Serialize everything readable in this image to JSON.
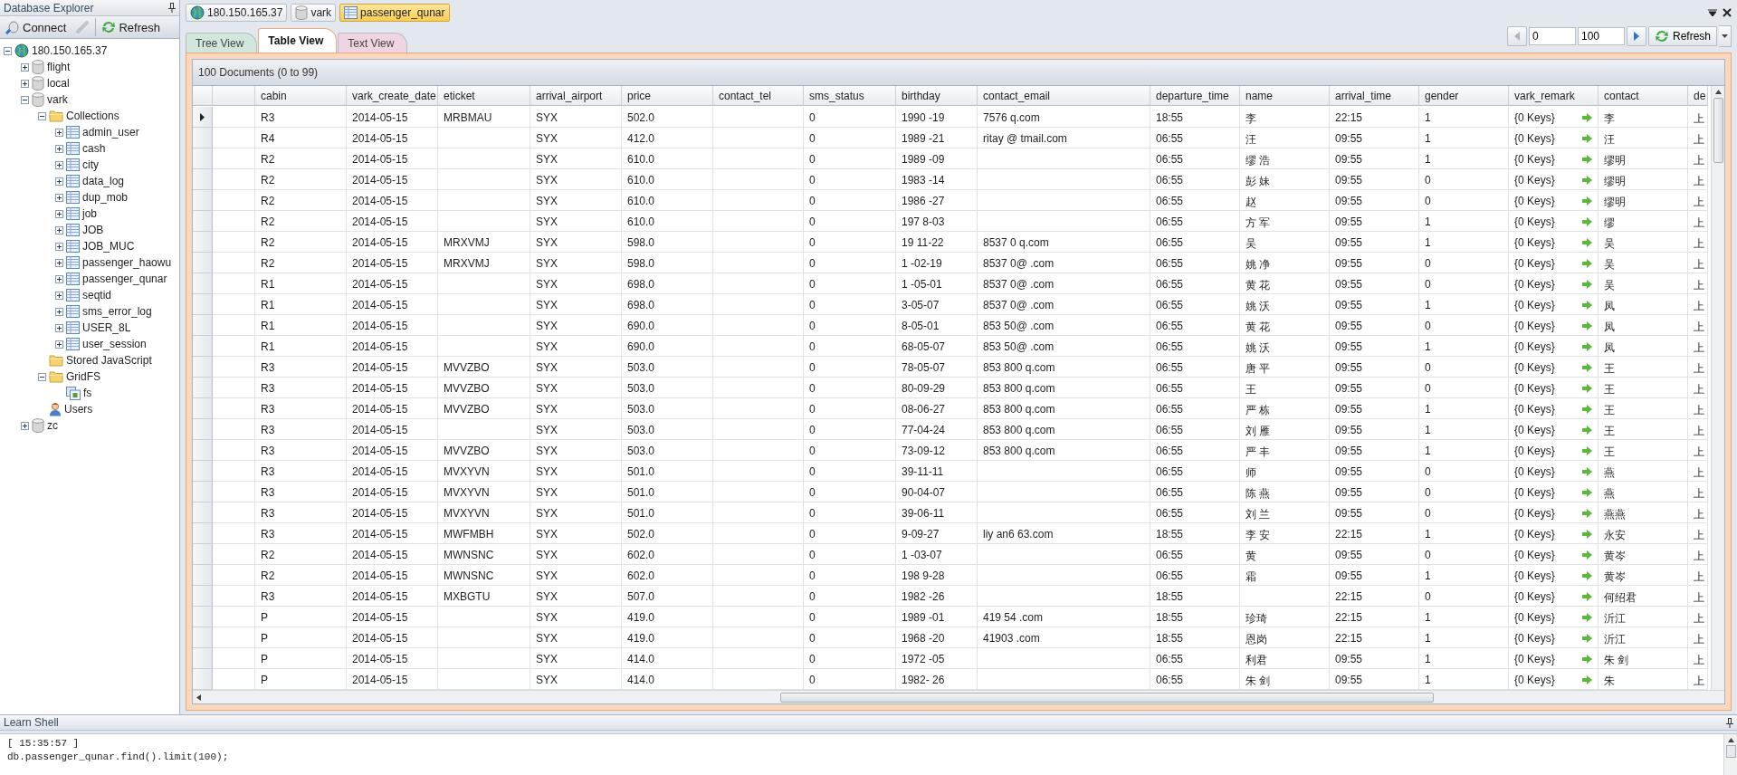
{
  "explorer": {
    "title": "Database Explorer",
    "toolbar": [
      {
        "kind": "connect",
        "label": "Connect",
        "disabled": false
      },
      {
        "kind": "disconnect",
        "disabled": true
      },
      {
        "kind": "refresh",
        "label": "Refresh",
        "disabled": false
      }
    ],
    "tree": [
      {
        "kind": "server",
        "label": "180.150.165.37",
        "expanded": true,
        "children": [
          {
            "kind": "database",
            "label": "flight",
            "expanded": false
          },
          {
            "kind": "database",
            "label": "local",
            "expanded": false
          },
          {
            "kind": "database",
            "label": "vark",
            "expanded": true,
            "children": [
              {
                "kind": "folder",
                "label": "Collections",
                "expanded": true,
                "children": [
                  {
                    "kind": "collection",
                    "label": "admin_user",
                    "expanded": false
                  },
                  {
                    "kind": "collection",
                    "label": "cash",
                    "expanded": false
                  },
                  {
                    "kind": "collection",
                    "label": "city",
                    "expanded": false
                  },
                  {
                    "kind": "collection",
                    "label": "data_log",
                    "expanded": false
                  },
                  {
                    "kind": "collection",
                    "label": "dup_mob",
                    "expanded": false
                  },
                  {
                    "kind": "collection",
                    "label": "job",
                    "expanded": false
                  },
                  {
                    "kind": "collection",
                    "label": "JOB",
                    "expanded": false
                  },
                  {
                    "kind": "collection",
                    "label": "JOB_MUC",
                    "expanded": false
                  },
                  {
                    "kind": "collection",
                    "label": "passenger_haowu",
                    "expanded": false
                  },
                  {
                    "kind": "collection",
                    "label": "passenger_qunar",
                    "expanded": false
                  },
                  {
                    "kind": "collection",
                    "label": "seqtid",
                    "expanded": false
                  },
                  {
                    "kind": "collection",
                    "label": "sms_error_log",
                    "expanded": false
                  },
                  {
                    "kind": "collection",
                    "label": "USER_8L",
                    "expanded": false
                  },
                  {
                    "kind": "collection",
                    "label": "user_session",
                    "expanded": false
                  }
                ]
              },
              {
                "kind": "folder",
                "label": "Stored JavaScript"
              },
              {
                "kind": "folder",
                "label": "GridFS",
                "expanded": true,
                "children": [
                  {
                    "kind": "gridfs",
                    "label": "fs"
                  }
                ]
              },
              {
                "kind": "users",
                "label": "Users"
              }
            ]
          },
          {
            "kind": "database",
            "label": "zc",
            "expanded": false
          }
        ]
      }
    ]
  },
  "breadcrumbs": [
    {
      "kind": "server",
      "label": "180.150.165.37",
      "selected": false
    },
    {
      "kind": "database",
      "label": "vark",
      "selected": false
    },
    {
      "kind": "collection",
      "label": "passenger_qunar",
      "selected": true
    }
  ],
  "view_tabs": [
    {
      "label": "Tree View",
      "selected": false,
      "color": "#d3e6dc"
    },
    {
      "label": "Table View",
      "selected": true,
      "color": "#ffffff"
    },
    {
      "label": "Text View",
      "selected": false,
      "color": "#f0d4e2"
    }
  ],
  "pager": {
    "start": "0",
    "limit": "100",
    "refresh": "Refresh"
  },
  "grid": {
    "summary": "100 Documents (0 to 99)",
    "columns": [
      {
        "label": "cabin",
        "kind": "text"
      },
      {
        "label": "vark_create_date",
        "kind": "text"
      },
      {
        "label": "eticket",
        "kind": "text"
      },
      {
        "label": "arrival_airport",
        "kind": "text"
      },
      {
        "label": "price",
        "kind": "text"
      },
      {
        "label": "contact_tel",
        "kind": "text"
      },
      {
        "label": "sms_status",
        "kind": "text"
      },
      {
        "label": "birthday",
        "kind": "text"
      },
      {
        "label": "contact_email",
        "kind": "text"
      },
      {
        "label": "departure_time",
        "kind": "text"
      },
      {
        "label": "name",
        "kind": "text"
      },
      {
        "label": "arrival_time",
        "kind": "text"
      },
      {
        "label": "gender",
        "kind": "text"
      },
      {
        "label": "vark_remark",
        "kind": "object"
      },
      {
        "label": "contact",
        "kind": "text"
      },
      {
        "label": "de",
        "kind": "text"
      }
    ],
    "rows": [
      {
        "current": true,
        "cells": [
          "R3",
          "2014-05-15",
          "MRBMAU",
          "SYX",
          "502.0",
          null,
          "0",
          "1990  -19",
          "7576   q.com",
          "18:55",
          "李",
          "22:15",
          "1",
          "{0 Keys}",
          "李",
          "上"
        ]
      },
      {
        "current": false,
        "cells": [
          "R4",
          "2014-05-15",
          null,
          "SYX",
          "412.0",
          null,
          "0",
          "1989  -21",
          "ritay  @  tmail.com",
          "06:55",
          "汪",
          "09:55",
          "1",
          "{0 Keys}",
          "汪",
          "上"
        ]
      },
      {
        "current": false,
        "cells": [
          "R2",
          "2014-05-15",
          null,
          "SYX",
          "610.0",
          null,
          "0",
          "1989  -09",
          null,
          "06:55",
          "缪  浩",
          "09:55",
          "1",
          "{0 Keys}",
          "缪明",
          "上"
        ]
      },
      {
        "current": false,
        "cells": [
          "R2",
          "2014-05-15",
          null,
          "SYX",
          "610.0",
          null,
          "0",
          "1983  -14",
          null,
          "06:55",
          "彭  妹",
          "09:55",
          "0",
          "{0 Keys}",
          "缪明",
          "上"
        ]
      },
      {
        "current": false,
        "cells": [
          "R2",
          "2014-05-15",
          null,
          "SYX",
          "610.0",
          null,
          "0",
          "1986  -27",
          null,
          "06:55",
          "赵",
          "09:55",
          "0",
          "{0 Keys}",
          "缪明",
          "上"
        ]
      },
      {
        "current": false,
        "cells": [
          "R2",
          "2014-05-15",
          null,
          "SYX",
          "610.0",
          null,
          "0",
          "197  8-03",
          null,
          "06:55",
          "方  军",
          "09:55",
          "1",
          "{0 Keys}",
          "缪",
          "上"
        ]
      },
      {
        "current": false,
        "cells": [
          "R2",
          "2014-05-15",
          "MRXVMJ",
          "SYX",
          "598.0",
          null,
          "0",
          "19  11-22",
          "8537  0  q.com",
          "06:55",
          "吴",
          "09:55",
          "1",
          "{0 Keys}",
          "吴",
          "上"
        ]
      },
      {
        "current": false,
        "cells": [
          "R2",
          "2014-05-15",
          "MRXVMJ",
          "SYX",
          "598.0",
          null,
          "0",
          "1  -02-19",
          "8537  0@  .com",
          "06:55",
          "姚  净",
          "09:55",
          "0",
          "{0 Keys}",
          "吴",
          "上"
        ]
      },
      {
        "current": false,
        "cells": [
          "R1",
          "2014-05-15",
          null,
          "SYX",
          "698.0",
          null,
          "0",
          "1  -05-01",
          "8537  0@  .com",
          "06:55",
          "黄  花",
          "09:55",
          "0",
          "{0 Keys}",
          "吴",
          "上"
        ]
      },
      {
        "current": false,
        "cells": [
          "R1",
          "2014-05-15",
          null,
          "SYX",
          "698.0",
          null,
          "0",
          "3-05-07",
          "8537  0@  .com",
          "06:55",
          "姚  沃",
          "09:55",
          "1",
          "{0 Keys}",
          "凤",
          "上"
        ]
      },
      {
        "current": false,
        "cells": [
          "R1",
          "2014-05-15",
          null,
          "SYX",
          "690.0",
          null,
          "0",
          "8-05-01",
          "853  50@  .com",
          "06:55",
          "黄  花",
          "09:55",
          "0",
          "{0 Keys}",
          "凤",
          "上"
        ]
      },
      {
        "current": false,
        "cells": [
          "R1",
          "2014-05-15",
          null,
          "SYX",
          "690.0",
          null,
          "0",
          "68-05-07",
          "853  50@  .com",
          "06:55",
          "姚  沃",
          "09:55",
          "1",
          "{0 Keys}",
          "凤",
          "上"
        ]
      },
      {
        "current": false,
        "cells": [
          "R3",
          "2014-05-15",
          "MVVZBO",
          "SYX",
          "503.0",
          null,
          "0",
          "78-05-07",
          "853  800  q.com",
          "06:55",
          "唐  平",
          "09:55",
          "0",
          "{0 Keys}",
          "王",
          "上"
        ]
      },
      {
        "current": false,
        "cells": [
          "R3",
          "2014-05-15",
          "MVVZBO",
          "SYX",
          "503.0",
          null,
          "0",
          "80-09-29",
          "853  800  q.com",
          "06:55",
          "王",
          "09:55",
          "0",
          "{0 Keys}",
          "王",
          "上"
        ]
      },
      {
        "current": false,
        "cells": [
          "R3",
          "2014-05-15",
          "MVVZBO",
          "SYX",
          "503.0",
          null,
          "0",
          "08-06-27",
          "853  800  q.com",
          "06:55",
          "严  栋",
          "09:55",
          "1",
          "{0 Keys}",
          "王",
          "上"
        ]
      },
      {
        "current": false,
        "cells": [
          "R3",
          "2014-05-15",
          null,
          "SYX",
          "503.0",
          null,
          "0",
          "77-04-24",
          "853  800  q.com",
          "06:55",
          "刘  雁",
          "09:55",
          "1",
          "{0 Keys}",
          "王",
          "上"
        ]
      },
      {
        "current": false,
        "cells": [
          "R3",
          "2014-05-15",
          "MVVZBO",
          "SYX",
          "503.0",
          null,
          "0",
          "73-09-12",
          "853  800  q.com",
          "06:55",
          "严  丰",
          "09:55",
          "1",
          "{0 Keys}",
          "王",
          "上"
        ]
      },
      {
        "current": false,
        "cells": [
          "R3",
          "2014-05-15",
          "MVXYVN",
          "SYX",
          "501.0",
          null,
          "0",
          "39-11-11",
          null,
          "06:55",
          "师",
          "09:55",
          "0",
          "{0 Keys}",
          "燕",
          "上"
        ]
      },
      {
        "current": false,
        "cells": [
          "R3",
          "2014-05-15",
          "MVXYVN",
          "SYX",
          "501.0",
          null,
          "0",
          "90-04-07",
          null,
          "06:55",
          "陈  燕",
          "09:55",
          "0",
          "{0 Keys}",
          "燕",
          "上"
        ]
      },
      {
        "current": false,
        "cells": [
          "R3",
          "2014-05-15",
          "MVXYVN",
          "SYX",
          "501.0",
          null,
          "0",
          "39-06-11",
          null,
          "06:55",
          "刘  兰",
          "09:55",
          "0",
          "{0 Keys}",
          "燕燕",
          "上"
        ]
      },
      {
        "current": false,
        "cells": [
          "R3",
          "2014-05-15",
          "MWFMBH",
          "SYX",
          "502.0",
          null,
          "0",
          "9-09-27",
          "liy  an6  63.com",
          "18:55",
          "李  安",
          "22:15",
          "1",
          "{0 Keys}",
          "永安",
          "上"
        ]
      },
      {
        "current": false,
        "cells": [
          "R2",
          "2014-05-15",
          "MWNSNC",
          "SYX",
          "602.0",
          null,
          "0",
          "1  -03-07",
          null,
          "06:55",
          "黄",
          "09:55",
          "0",
          "{0 Keys}",
          "黄岑",
          "上"
        ]
      },
      {
        "current": false,
        "cells": [
          "R2",
          "2014-05-15",
          "MWNSNC",
          "SYX",
          "602.0",
          null,
          "0",
          "198  9-28",
          null,
          "06:55",
          "霜",
          "09:55",
          "1",
          "{0 Keys}",
          "黄岑",
          "上"
        ]
      },
      {
        "current": false,
        "cells": [
          "R3",
          "2014-05-15",
          "MXBGTU",
          "SYX",
          "507.0",
          null,
          "0",
          "1982  -26",
          null,
          "18:55",
          null,
          "22:15",
          "0",
          "{0 Keys}",
          "何绍君",
          "上"
        ]
      },
      {
        "current": false,
        "cells": [
          "P",
          "2014-05-15",
          null,
          "SYX",
          "419.0",
          null,
          "0",
          "1989  -01",
          "419  54  .com",
          "18:55",
          "珍琦",
          "22:15",
          "1",
          "{0 Keys}",
          "沂江",
          "上"
        ]
      },
      {
        "current": false,
        "cells": [
          "P",
          "2014-05-15",
          null,
          "SYX",
          "419.0",
          null,
          "0",
          "1968  -20",
          "41903  .com",
          "18:55",
          "恩岗",
          "22:15",
          "1",
          "{0 Keys}",
          "沂江",
          "上"
        ]
      },
      {
        "current": false,
        "cells": [
          "P",
          "2014-05-15",
          null,
          "SYX",
          "414.0",
          null,
          "0",
          "1972  -05",
          null,
          "06:55",
          "利君",
          "09:55",
          "1",
          "{0 Keys}",
          "朱  剑",
          "上"
        ]
      },
      {
        "current": false,
        "cells": [
          "P",
          "2014-05-15",
          null,
          "SYX",
          "414.0",
          null,
          "0",
          "1982-  26",
          null,
          "06:55",
          "朱  剑",
          "09:55",
          "1",
          "{0 Keys}",
          "朱",
          "上"
        ]
      }
    ]
  },
  "shell": {
    "title": "Learn Shell",
    "lines": [
      "[ 15:35:57 ]",
      "db.passenger_qunar.find().limit(100);"
    ]
  }
}
